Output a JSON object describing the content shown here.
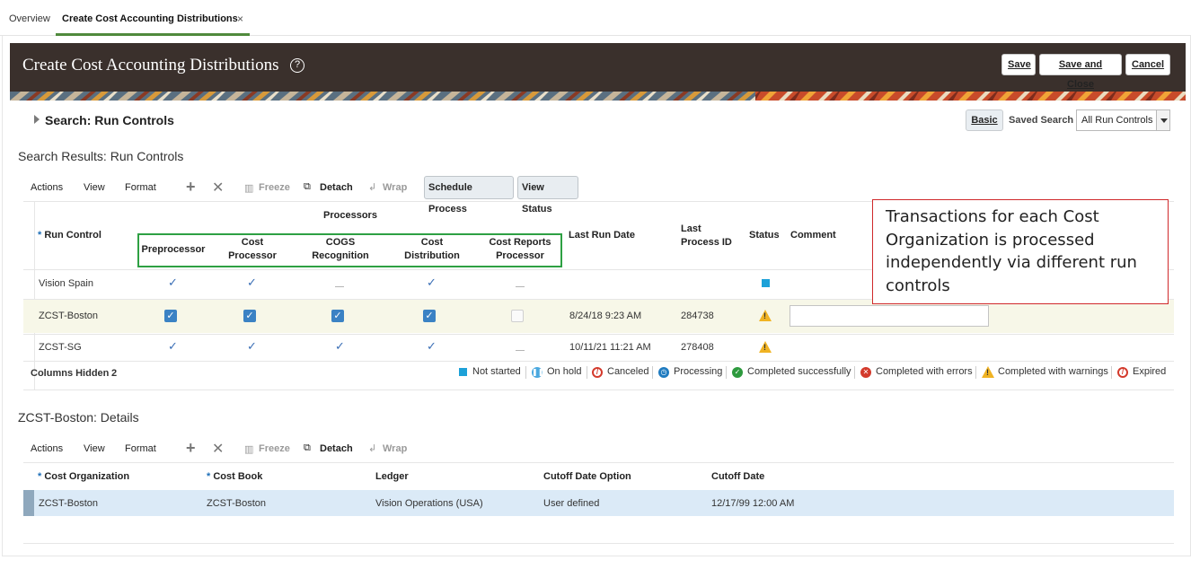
{
  "tabs": [
    {
      "label": "Overview"
    },
    {
      "label": "Create Cost Accounting Distributions",
      "close": "×"
    }
  ],
  "header": {
    "title": "Create Cost Accounting Distributions",
    "help": "?",
    "buttons": {
      "save": "Save",
      "save_close": "Save and Close",
      "cancel": "Cancel"
    }
  },
  "search": {
    "title": "Search: Run Controls",
    "basic": "Basic",
    "saved_search_label": "Saved Search",
    "saved_search_value": "All Run Controls"
  },
  "results": {
    "title": "Search Results: Run Controls",
    "toolbar": {
      "actions": "Actions",
      "view": "View",
      "format": "Format",
      "freeze": "Freeze",
      "detach": "Detach",
      "wrap": "Wrap",
      "schedule": "Schedule Process",
      "view_status": "View Status"
    },
    "columns": {
      "run_control": "Run Control",
      "processors": "Processors",
      "preprocessor": "Preprocessor",
      "cost_processor": "Cost Processor",
      "cogs": "COGS Recognition",
      "cost_distribution": "Cost Distribution",
      "cost_reports": "Cost Reports Processor",
      "last_run_date": "Last Run Date",
      "last_process_id": "Last Process ID",
      "status": "Status",
      "comment": "Comment"
    },
    "rows": [
      {
        "run_control": "Vision Spain",
        "last_run_date": "",
        "last_process_id": "",
        "status": "not-started"
      },
      {
        "run_control": "ZCST-Boston",
        "last_run_date": "8/24/18 9:23 AM",
        "last_process_id": "284738",
        "status": "completed-with-warnings"
      },
      {
        "run_control": "ZCST-SG",
        "last_run_date": "10/11/21 11:21 AM",
        "last_process_id": "278408",
        "status": "completed-with-warnings"
      }
    ],
    "columns_hidden_label": "Columns Hidden",
    "columns_hidden_count": "2",
    "legend": [
      "Not started",
      "On hold",
      "Canceled",
      "Processing",
      "Completed successfully",
      "Completed with errors",
      "Completed with warnings",
      "Expired"
    ]
  },
  "note": "Transactions for each Cost Organization is processed independently via different run controls",
  "details": {
    "title": "ZCST-Boston: Details",
    "columns": {
      "cost_org": "Cost Organization",
      "cost_book": "Cost Book",
      "ledger": "Ledger",
      "cutoff_option": "Cutoff Date Option",
      "cutoff_date": "Cutoff Date"
    },
    "row": {
      "cost_org": "ZCST-Boston",
      "cost_book": "ZCST-Boston",
      "ledger": "Vision Operations (USA)",
      "cutoff_option": "User defined",
      "cutoff_date": "12/17/99 12:00 AM"
    }
  },
  "colors": {
    "header_bg": "#3a302c",
    "accent_green": "#2ea043",
    "note_red": "#d0292b",
    "check_blue": "#3b6fb6"
  }
}
